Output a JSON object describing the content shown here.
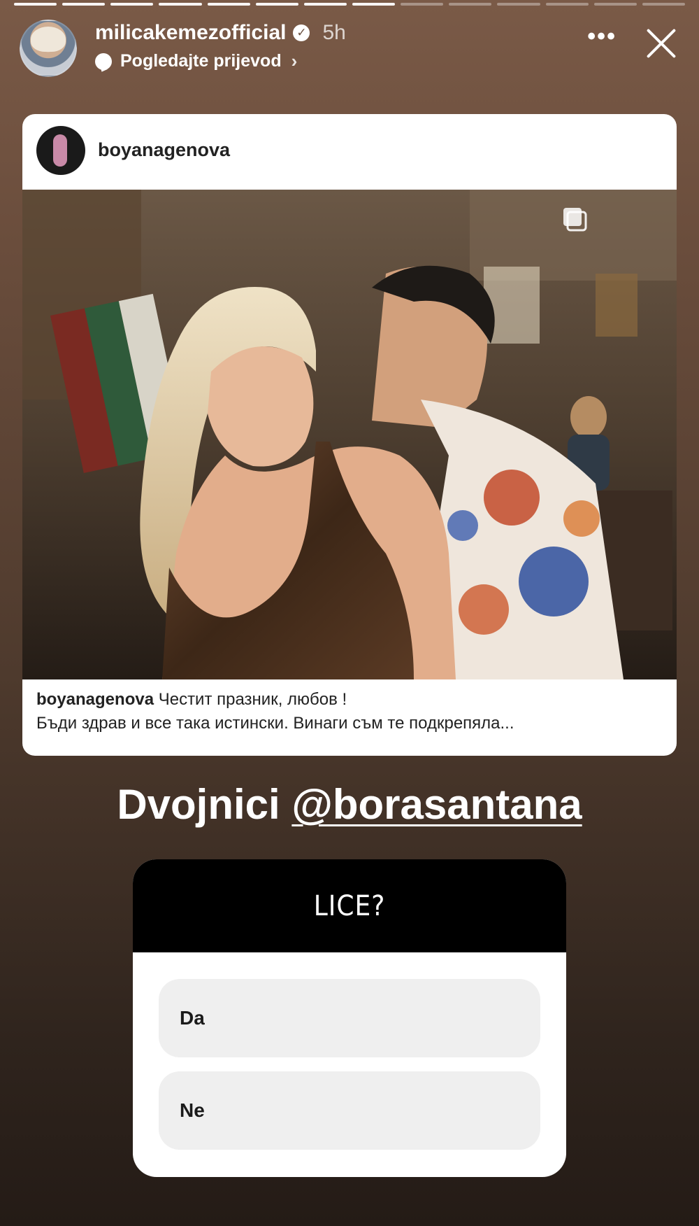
{
  "progress": {
    "total_segments": 14,
    "completed_segments": 8
  },
  "header": {
    "username": "milicakemezofficial",
    "time": "5h",
    "translate_label": "Pogledajte prijevod",
    "icons": [
      "verified-icon",
      "translate-icon",
      "chevron-right-icon",
      "more-icon",
      "close-icon"
    ]
  },
  "shared_post": {
    "username": "boyanagenova",
    "caption_user": "boyanagenova",
    "caption_line1": "Честит празник, любов !",
    "caption_line2": "Бъди здрав и все така истински. Винаги съм те подкрепяла...",
    "icons": [
      "carousel-icon"
    ]
  },
  "mention": {
    "text": "Dvojnici ",
    "tag": "@borasantana"
  },
  "poll": {
    "question": "LICE?",
    "options": [
      "Da",
      "Ne"
    ]
  }
}
